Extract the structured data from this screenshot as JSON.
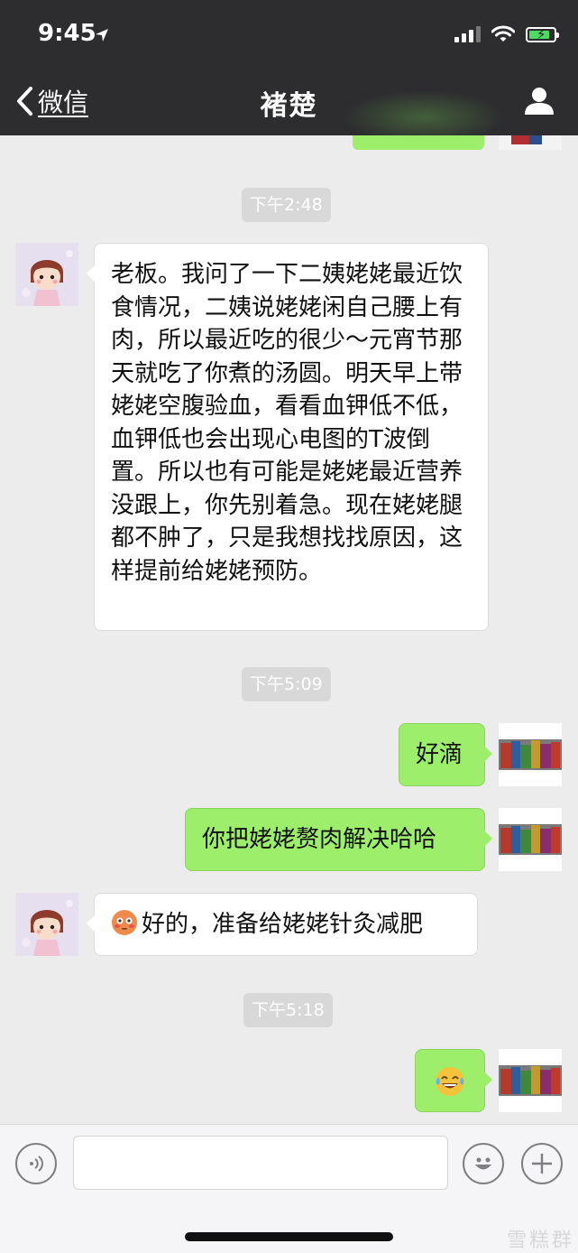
{
  "status_bar": {
    "time": "9:45"
  },
  "nav": {
    "back_label": "微信",
    "title": "褚楚"
  },
  "messages": {
    "t1": "下午2:48",
    "m1": "老板。我问了一下二姨姥姥最近饮食情况，二姨说姥姥闲自己腰上有肉，所以最近吃的很少～元宵节那天就吃了你煮的汤圆。明天早上带姥姥空腹验血，看看血钾低不低，血钾低也会出现心电图的T波倒置。所以也有可能是姥姥最近营养没跟上，你先别着急。现在姥姥腿都不肿了，只是我想找找原因，这样提前给姥姥预防。",
    "t2": "下午5:09",
    "m2": "好滴",
    "m3": "你把姥姥赘肉解决哈哈",
    "m4": "好的，准备给姥姥针灸减肥",
    "t3": "下午5:18"
  },
  "icons": {
    "back": "chevron-left-icon",
    "profile": "person-icon",
    "voice": "voice-icon",
    "emoji": "emoji-icon",
    "plus": "plus-icon",
    "location": "location-arrow-icon",
    "wifi": "wifi-icon",
    "battery": "battery-charging-icon"
  },
  "colors": {
    "nav_bg": "#2d2d2f",
    "chat_bg": "#ececec",
    "outgoing_bubble": "#9def6b",
    "incoming_bubble": "#ffffff",
    "timestamp_bg": "#d8d8d8"
  },
  "watermark": "雪糕群"
}
